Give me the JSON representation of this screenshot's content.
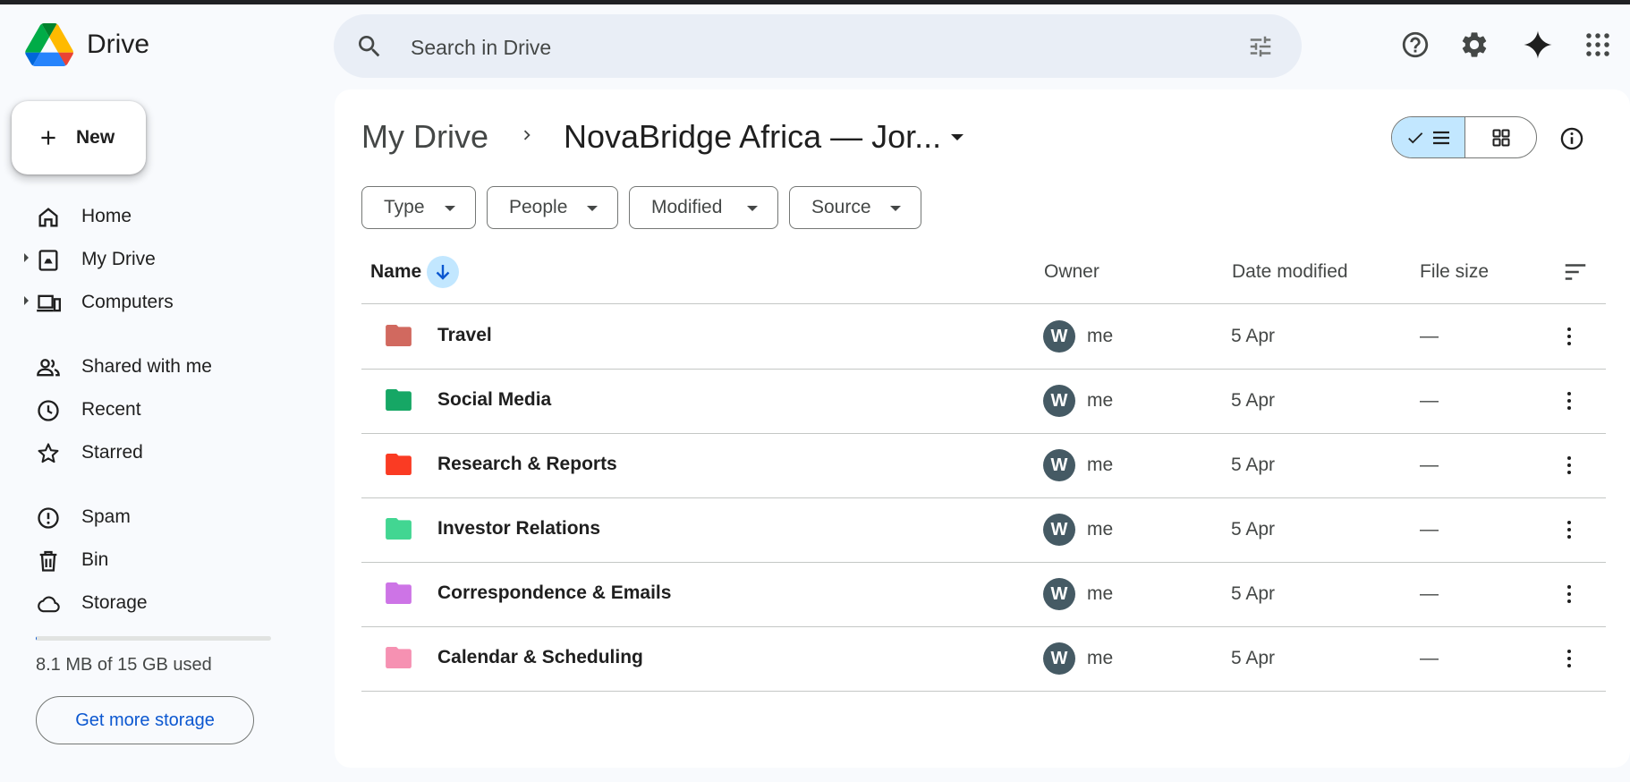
{
  "app": {
    "title": "Drive"
  },
  "search": {
    "placeholder": "Search in Drive"
  },
  "header_icons": [
    "help-icon",
    "settings-icon",
    "gemini-icon",
    "apps-grid-icon"
  ],
  "sidebar": {
    "new_label": "New",
    "items": [
      {
        "label": "Home",
        "icon": "home-icon"
      },
      {
        "label": "My Drive",
        "icon": "my-drive-icon"
      },
      {
        "label": "Computers",
        "icon": "computers-icon"
      },
      {
        "label": "Shared with me",
        "icon": "shared-icon"
      },
      {
        "label": "Recent",
        "icon": "clock-icon"
      },
      {
        "label": "Starred",
        "icon": "star-icon"
      },
      {
        "label": "Spam",
        "icon": "spam-icon"
      },
      {
        "label": "Bin",
        "icon": "bin-icon"
      },
      {
        "label": "Storage",
        "icon": "cloud-icon"
      }
    ],
    "storage_used": 0.001,
    "storage_text": "8.1 MB of 15 GB used",
    "get_storage_label": "Get more storage"
  },
  "breadcrumb": {
    "root": "My Drive",
    "current": "NovaBridge Africa — Jor..."
  },
  "filters": [
    "Type",
    "People",
    "Modified",
    "Source"
  ],
  "table": {
    "headers": {
      "name": "Name",
      "owner": "Owner",
      "date": "Date modified",
      "size": "File size"
    },
    "rows": [
      {
        "name": "Travel",
        "owner_initial": "W",
        "owner": "me",
        "date": "5 Apr",
        "size": "—",
        "color": "#d1695f"
      },
      {
        "name": "Social Media",
        "owner_initial": "W",
        "owner": "me",
        "date": "5 Apr",
        "size": "—",
        "color": "#16a765"
      },
      {
        "name": "Research & Reports",
        "owner_initial": "W",
        "owner": "me",
        "date": "5 Apr",
        "size": "—",
        "color": "#fa3b23"
      },
      {
        "name": "Investor Relations",
        "owner_initial": "W",
        "owner": "me",
        "date": "5 Apr",
        "size": "—",
        "color": "#42d692"
      },
      {
        "name": "Correspondence & Emails",
        "owner_initial": "W",
        "owner": "me",
        "date": "5 Apr",
        "size": "—",
        "color": "#cd74e6"
      },
      {
        "name": "Calendar & Scheduling",
        "owner_initial": "W",
        "owner": "me",
        "date": "5 Apr",
        "size": "—",
        "color": "#f691b2"
      }
    ]
  }
}
